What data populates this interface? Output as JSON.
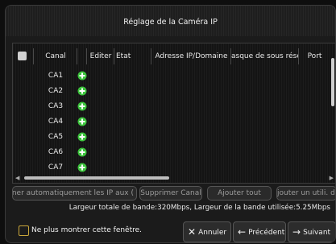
{
  "dialog": {
    "title": "Réglage de la Caméra IP"
  },
  "table": {
    "headers": {
      "canal": "Canal",
      "editer": "Editer",
      "etat": "Etat",
      "adresse": "Adresse IP/Domaine",
      "masque": "asque de sous résea",
      "port": "Port"
    },
    "rows": [
      "CA1",
      "CA2",
      "CA3",
      "CA4",
      "CA5",
      "CA6",
      "CA7"
    ],
    "add_icon_color": "#3cc43c"
  },
  "buttons": {
    "auto_add": "ner automatiquement les IP aux (",
    "delete_channel": "Supprimer Canal",
    "add_all": "Ajouter tout",
    "add_user_defined": "jouter un utili. défi"
  },
  "bandwidth": {
    "text": "Largeur totale de bande:320Mbps,  Largeur de la bande utilisée:5.25Mbps"
  },
  "footer": {
    "dont_show_again": "Ne plus montrer cette fenêtre.",
    "cancel": "Annuler",
    "previous": "Précédent",
    "next": "Suivant"
  }
}
